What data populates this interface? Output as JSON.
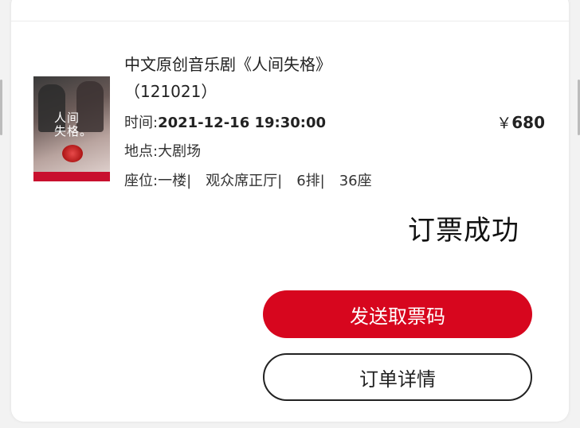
{
  "order": {
    "title_line1": "中文原创音乐剧《人间失格》",
    "title_line2": "（121021）",
    "time_label": "时间:",
    "time_value": "2021-12-16 19:30:00",
    "venue_label": "地点:",
    "venue_value": "大剧场",
    "seat_label": "座位:",
    "seat_value": "一楼|　观众席正厅|　6排|　36座",
    "price_symbol": "￥",
    "price_value": "680",
    "poster_text": "人间\n失格。"
  },
  "status": {
    "text": "订票成功"
  },
  "actions": {
    "send_code_label": "发送取票码",
    "order_detail_label": "订单详情"
  },
  "colors": {
    "accent": "#d7061e",
    "text": "#222222",
    "background": "#f2f2f2"
  }
}
